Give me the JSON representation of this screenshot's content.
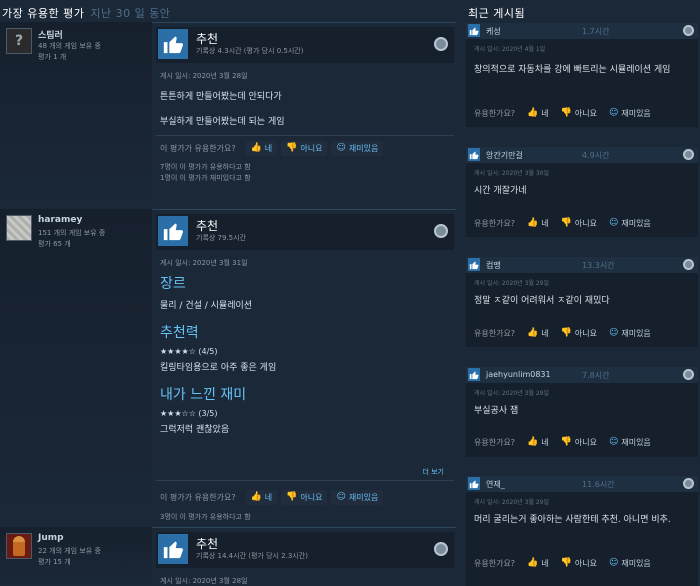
{
  "left_header": {
    "title": "가장 유용한 평가",
    "period": "지난 30 일 동안"
  },
  "right_header": {
    "title": "최근 게시됨"
  },
  "reviews": [
    {
      "user": "스팀러",
      "games": "48 개의 게임 보유 중",
      "review_count": "평가 1 개",
      "verdict": "추천",
      "hours": "기록상 4.3시간 (평가 당시 0.5시간)",
      "posted": "게시 일시: 2020년 3월 28일",
      "lines": [
        "튼튼하게 만들어봤는데 안되다가",
        "부실하게 만들어봤는데 되는 게임"
      ],
      "helpful_q": "이 평가가 유용한가요?",
      "yes": "네",
      "no": "아니요",
      "funny": "재미있음",
      "counts": [
        "7명이 이 평가가 유용하다고 함",
        "1명이 이 평가가 재미있다고 함"
      ]
    },
    {
      "user": "haramey",
      "games": "151 개의 게임 보유 중",
      "review_count": "평가 65 개",
      "verdict": "추천",
      "hours": "기록상 79.5시간",
      "posted": "게시 일시: 2020년 3월 31일",
      "genre_h": "장르",
      "genre": "물리 / 건설 / 시뮬레이션",
      "rec_h": "추천력",
      "rec_stars": "★★★★☆ (4/5)",
      "rec_text": "킬링타임용으로 아주 좋은 게임",
      "fun_h": "내가 느낀 재미",
      "fun_stars": "★★★☆☆ (3/5)",
      "fun_text": "그럭저럭 괜찮았음",
      "more": "더 보기",
      "helpful_q": "이 평가가 유용한가요?",
      "yes": "네",
      "no": "아니요",
      "funny": "재미있음",
      "counts": [
        "3명이 이 평가가 유용하다고 함"
      ]
    },
    {
      "user": "Jump",
      "games": "22 개의 게임 보유 중",
      "review_count": "평가 15 개",
      "verdict": "추천",
      "hours": "기록상 14.4시간 (평가 당시 2.3시간)",
      "posted": "게시 일시: 2020년 3월 28일"
    }
  ],
  "posts": [
    {
      "name": "케성",
      "hours": "1.7시간",
      "date": "게시 일시: 2020년 4월 1일",
      "text": "창의적으로 자동차를 강에 빠트리는 시뮬레이션 게임"
    },
    {
      "name": "앙간기만걸",
      "hours": "4.9시간",
      "date": "게시 일시: 2020년 3월 30일",
      "text": "시간 개잘가네"
    },
    {
      "name": "컴맹",
      "hours": "13.3시간",
      "date": "게시 일시: 2020년 3월 29일",
      "text": "정말 ㅈ같이 어려워서 ㅈ같이 재밌다"
    },
    {
      "name": "jaehyunlim0831",
      "hours": "7.8시간",
      "date": "게시 일시: 2020년 3월 29일",
      "text": "부실공사 잼"
    },
    {
      "name": "연재_",
      "hours": "11.6시간",
      "date": "게시 일시: 2020년 3월 29일",
      "text": "머리 굴리는거 좋아하는 사람한테 추천. 아니면 비추."
    }
  ],
  "post_vote": {
    "q": "유용한가요?",
    "yes": "네",
    "no": "아니요",
    "funny": "재미있음"
  },
  "icons": {
    "thumb": "thumbs-up-icon",
    "steam": "steam-icon"
  },
  "colors": {
    "background": "#1b2838",
    "accent": "#67c1f5",
    "thumb_bg": "#2a6fa8"
  }
}
